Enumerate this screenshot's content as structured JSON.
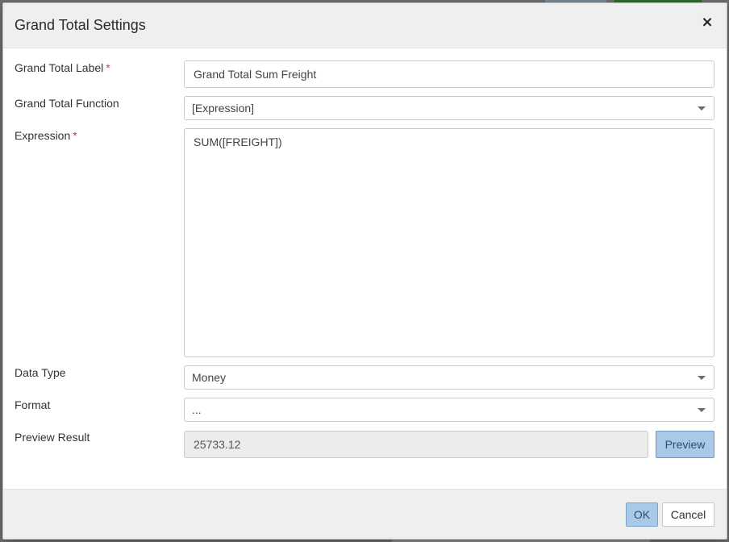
{
  "dialog": {
    "title": "Grand Total Settings",
    "close_symbol": "×"
  },
  "fields": {
    "label": {
      "label": "Grand Total Label",
      "required_mark": "*",
      "value": "Grand Total Sum Freight"
    },
    "function": {
      "label": "Grand Total Function",
      "selected": "[Expression]"
    },
    "expression": {
      "label": "Expression",
      "required_mark": "*",
      "value": "SUM([FREIGHT])"
    },
    "data_type": {
      "label": "Data Type",
      "selected": "Money"
    },
    "format": {
      "label": "Format",
      "selected": "..."
    },
    "preview_result": {
      "label": "Preview Result",
      "value": "25733.12",
      "button_label": "Preview"
    }
  },
  "footer": {
    "ok_label": "OK",
    "cancel_label": "Cancel"
  },
  "colors": {
    "required": "#d9302c",
    "primary_button": "#a9c9e6",
    "header_bg": "#efefef"
  },
  "icons": {
    "close": "close-icon",
    "dropdown": "chevron-down-icon"
  }
}
